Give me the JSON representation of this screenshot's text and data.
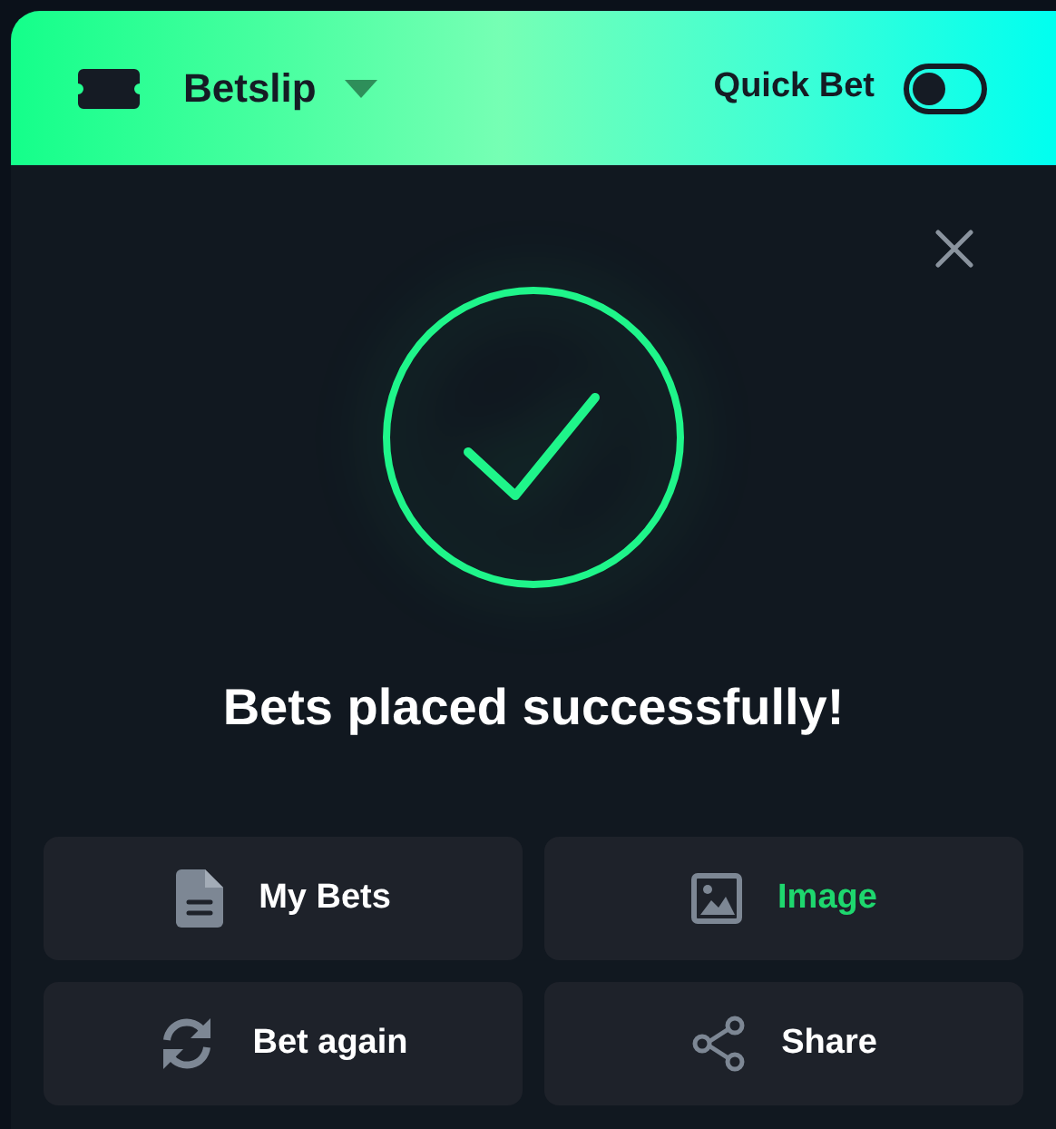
{
  "header": {
    "title": "Betslip",
    "quick_bet": {
      "label": "Quick Bet",
      "on": false
    }
  },
  "message": "Bets placed successfully!",
  "actions": [
    {
      "label": "My Bets",
      "kind": "document",
      "selected": false
    },
    {
      "label": "Image",
      "kind": "image",
      "selected": true
    },
    {
      "label": "Bet again",
      "kind": "repeat",
      "selected": false
    },
    {
      "label": "Share",
      "kind": "share",
      "selected": false
    }
  ]
}
